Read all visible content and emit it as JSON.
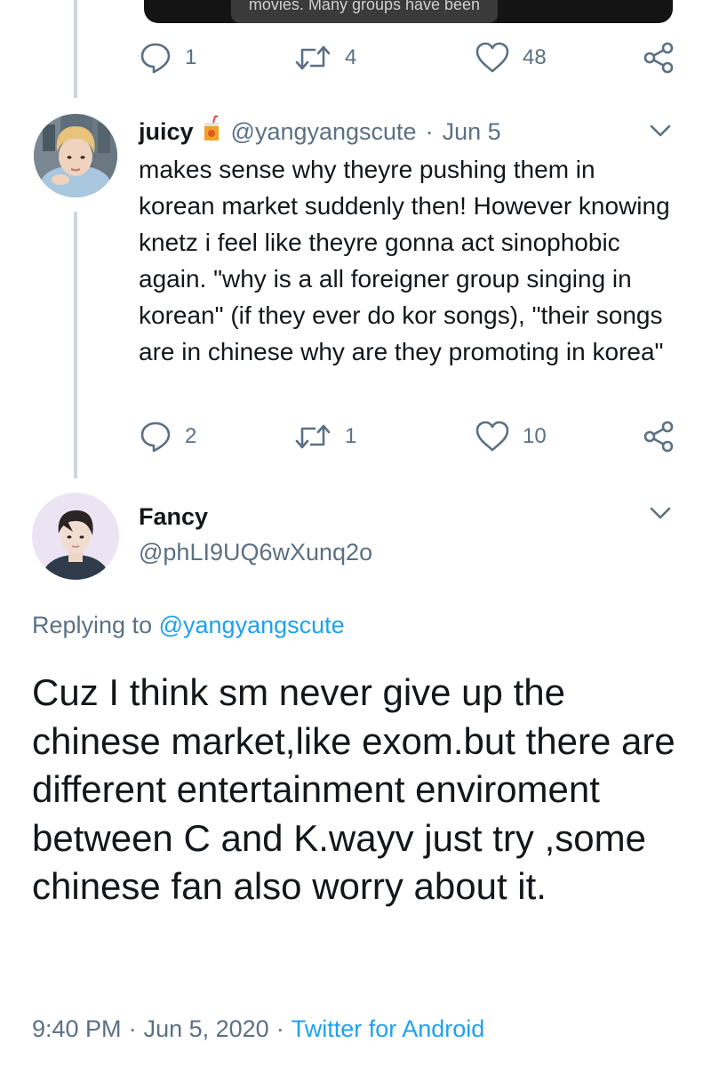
{
  "quoted_media": {
    "caption": "movies. Many groups have been"
  },
  "prev_tweet": {
    "actions": {
      "replies": "1",
      "retweets": "4",
      "likes": "48"
    }
  },
  "tweet1": {
    "name": "juicy",
    "handle": "@yangyangscute",
    "separator": "·",
    "date": "Jun 5",
    "text": "makes sense why theyre pushing them in korean market suddenly then! However knowing knetz i feel like theyre gonna act sinophobic again. \"why is a all foreigner group singing in korean\" (if they ever do kor songs), \"their songs are in chinese why are they promoting in korea\"",
    "actions": {
      "replies": "2",
      "retweets": "1",
      "likes": "10"
    }
  },
  "tweet2": {
    "name": "Fancy",
    "handle": "@phLI9UQ6wXunq2o",
    "replying_prefix": "Replying to",
    "replying_handle": "@yangyangscute",
    "text": "Cuz I think sm never give up the chinese market,like exom.but there are different entertainment enviroment between C and K.wayv just try ,some chinese fan also worry about it.",
    "time": "9:40 PM",
    "separator": "·",
    "date": "Jun 5, 2020",
    "source": "Twitter for Android"
  },
  "icons": {
    "reply": "reply-icon",
    "retweet": "retweet-icon",
    "like": "heart-icon",
    "share": "share-icon",
    "more": "chevron-down-icon"
  },
  "colors": {
    "text": "#14171a",
    "secondary": "#5b7083",
    "link": "#1da1f2",
    "thread_line": "#cdd6dd"
  }
}
